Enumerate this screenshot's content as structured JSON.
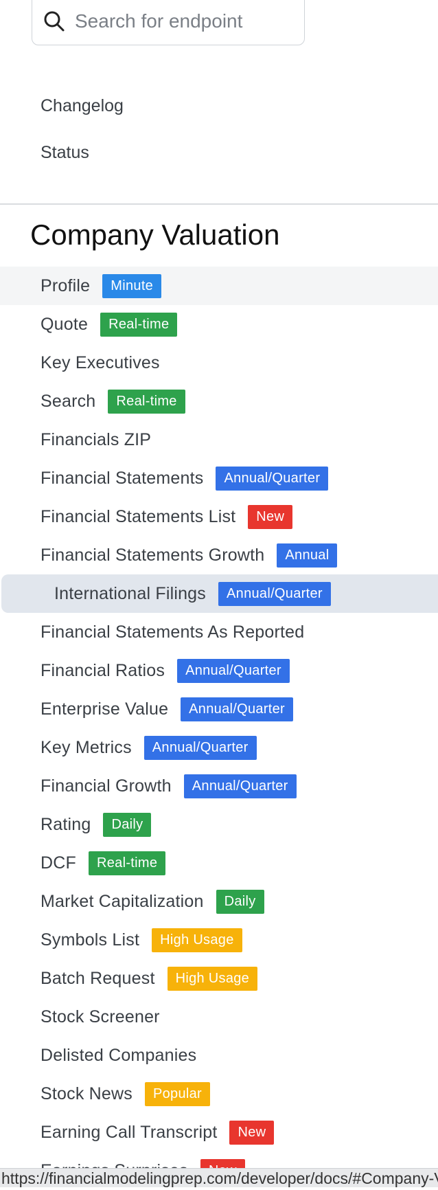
{
  "search": {
    "placeholder": "Search for endpoint",
    "value": ""
  },
  "links": {
    "changelog": "Changelog",
    "status": "Status"
  },
  "section": {
    "title": "Company Valuation"
  },
  "badge_colors": {
    "blue": "#2f80ed",
    "indigo": "#3371e7",
    "green": "#2ea24c",
    "red": "#e8362e",
    "yellow": "#f7b20a"
  },
  "nav_items": [
    {
      "label": "Profile",
      "badge": "Minute",
      "badge_color": "#2a89e8",
      "state": "hover"
    },
    {
      "label": "Quote",
      "badge": "Real-time",
      "badge_color": "#2ea24c"
    },
    {
      "label": "Key Executives",
      "badge": ""
    },
    {
      "label": "Search",
      "badge": "Real-time",
      "badge_color": "#2ea24c"
    },
    {
      "label": "Financials ZIP",
      "badge": ""
    },
    {
      "label": "Financial Statements",
      "badge": "Annual/Quarter",
      "badge_color": "#3371e7"
    },
    {
      "label": "Financial Statements List",
      "badge": "New",
      "badge_color": "#e8362e"
    },
    {
      "label": "Financial Statements Growth",
      "badge": "Annual",
      "badge_color": "#3371e7"
    },
    {
      "label": "International Filings",
      "badge": "Annual/Quarter",
      "badge_color": "#3371e7",
      "state": "active"
    },
    {
      "label": "Financial Statements As Reported",
      "badge": ""
    },
    {
      "label": "Financial Ratios",
      "badge": "Annual/Quarter",
      "badge_color": "#3371e7"
    },
    {
      "label": "Enterprise Value",
      "badge": "Annual/Quarter",
      "badge_color": "#3371e7"
    },
    {
      "label": "Key Metrics",
      "badge": "Annual/Quarter",
      "badge_color": "#3371e7"
    },
    {
      "label": "Financial Growth",
      "badge": "Annual/Quarter",
      "badge_color": "#3371e7"
    },
    {
      "label": "Rating",
      "badge": "Daily",
      "badge_color": "#2ea24c"
    },
    {
      "label": "DCF",
      "badge": "Real-time",
      "badge_color": "#2ea24c"
    },
    {
      "label": "Market Capitalization",
      "badge": "Daily",
      "badge_color": "#2ea24c"
    },
    {
      "label": "Symbols List",
      "badge": "High Usage",
      "badge_color": "#f7b20a"
    },
    {
      "label": "Batch Request",
      "badge": "High Usage",
      "badge_color": "#f7b20a"
    },
    {
      "label": "Stock Screener",
      "badge": ""
    },
    {
      "label": "Delisted Companies",
      "badge": ""
    },
    {
      "label": "Stock News",
      "badge": "Popular",
      "badge_color": "#f7b20a"
    },
    {
      "label": "Earning Call Transcript",
      "badge": "New",
      "badge_color": "#e8362e"
    },
    {
      "label": "Earnings Surprises",
      "badge": "New",
      "badge_color": "#e8362e"
    }
  ],
  "status_bar": {
    "url": "https://financialmodelingprep.com/developer/docs/#Company-Valuation"
  }
}
